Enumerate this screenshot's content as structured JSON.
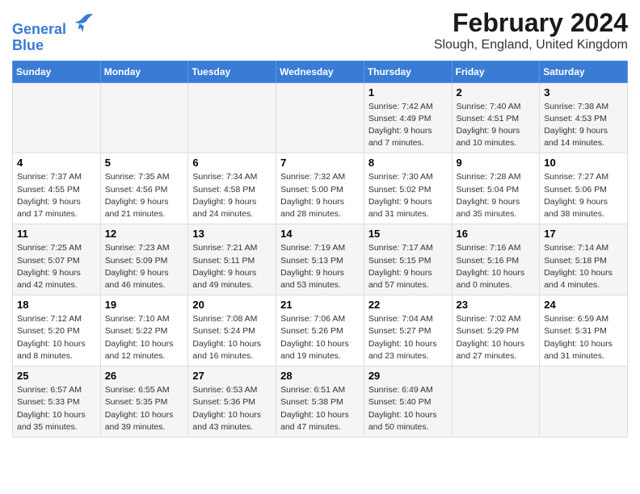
{
  "logo": {
    "line1": "General",
    "line2": "Blue"
  },
  "title": "February 2024",
  "location": "Slough, England, United Kingdom",
  "days_of_week": [
    "Sunday",
    "Monday",
    "Tuesday",
    "Wednesday",
    "Thursday",
    "Friday",
    "Saturday"
  ],
  "weeks": [
    [
      {
        "day": "",
        "info": ""
      },
      {
        "day": "",
        "info": ""
      },
      {
        "day": "",
        "info": ""
      },
      {
        "day": "",
        "info": ""
      },
      {
        "day": "1",
        "info": "Sunrise: 7:42 AM\nSunset: 4:49 PM\nDaylight: 9 hours\nand 7 minutes."
      },
      {
        "day": "2",
        "info": "Sunrise: 7:40 AM\nSunset: 4:51 PM\nDaylight: 9 hours\nand 10 minutes."
      },
      {
        "day": "3",
        "info": "Sunrise: 7:38 AM\nSunset: 4:53 PM\nDaylight: 9 hours\nand 14 minutes."
      }
    ],
    [
      {
        "day": "4",
        "info": "Sunrise: 7:37 AM\nSunset: 4:55 PM\nDaylight: 9 hours\nand 17 minutes."
      },
      {
        "day": "5",
        "info": "Sunrise: 7:35 AM\nSunset: 4:56 PM\nDaylight: 9 hours\nand 21 minutes."
      },
      {
        "day": "6",
        "info": "Sunrise: 7:34 AM\nSunset: 4:58 PM\nDaylight: 9 hours\nand 24 minutes."
      },
      {
        "day": "7",
        "info": "Sunrise: 7:32 AM\nSunset: 5:00 PM\nDaylight: 9 hours\nand 28 minutes."
      },
      {
        "day": "8",
        "info": "Sunrise: 7:30 AM\nSunset: 5:02 PM\nDaylight: 9 hours\nand 31 minutes."
      },
      {
        "day": "9",
        "info": "Sunrise: 7:28 AM\nSunset: 5:04 PM\nDaylight: 9 hours\nand 35 minutes."
      },
      {
        "day": "10",
        "info": "Sunrise: 7:27 AM\nSunset: 5:06 PM\nDaylight: 9 hours\nand 38 minutes."
      }
    ],
    [
      {
        "day": "11",
        "info": "Sunrise: 7:25 AM\nSunset: 5:07 PM\nDaylight: 9 hours\nand 42 minutes."
      },
      {
        "day": "12",
        "info": "Sunrise: 7:23 AM\nSunset: 5:09 PM\nDaylight: 9 hours\nand 46 minutes."
      },
      {
        "day": "13",
        "info": "Sunrise: 7:21 AM\nSunset: 5:11 PM\nDaylight: 9 hours\nand 49 minutes."
      },
      {
        "day": "14",
        "info": "Sunrise: 7:19 AM\nSunset: 5:13 PM\nDaylight: 9 hours\nand 53 minutes."
      },
      {
        "day": "15",
        "info": "Sunrise: 7:17 AM\nSunset: 5:15 PM\nDaylight: 9 hours\nand 57 minutes."
      },
      {
        "day": "16",
        "info": "Sunrise: 7:16 AM\nSunset: 5:16 PM\nDaylight: 10 hours\nand 0 minutes."
      },
      {
        "day": "17",
        "info": "Sunrise: 7:14 AM\nSunset: 5:18 PM\nDaylight: 10 hours\nand 4 minutes."
      }
    ],
    [
      {
        "day": "18",
        "info": "Sunrise: 7:12 AM\nSunset: 5:20 PM\nDaylight: 10 hours\nand 8 minutes."
      },
      {
        "day": "19",
        "info": "Sunrise: 7:10 AM\nSunset: 5:22 PM\nDaylight: 10 hours\nand 12 minutes."
      },
      {
        "day": "20",
        "info": "Sunrise: 7:08 AM\nSunset: 5:24 PM\nDaylight: 10 hours\nand 16 minutes."
      },
      {
        "day": "21",
        "info": "Sunrise: 7:06 AM\nSunset: 5:26 PM\nDaylight: 10 hours\nand 19 minutes."
      },
      {
        "day": "22",
        "info": "Sunrise: 7:04 AM\nSunset: 5:27 PM\nDaylight: 10 hours\nand 23 minutes."
      },
      {
        "day": "23",
        "info": "Sunrise: 7:02 AM\nSunset: 5:29 PM\nDaylight: 10 hours\nand 27 minutes."
      },
      {
        "day": "24",
        "info": "Sunrise: 6:59 AM\nSunset: 5:31 PM\nDaylight: 10 hours\nand 31 minutes."
      }
    ],
    [
      {
        "day": "25",
        "info": "Sunrise: 6:57 AM\nSunset: 5:33 PM\nDaylight: 10 hours\nand 35 minutes."
      },
      {
        "day": "26",
        "info": "Sunrise: 6:55 AM\nSunset: 5:35 PM\nDaylight: 10 hours\nand 39 minutes."
      },
      {
        "day": "27",
        "info": "Sunrise: 6:53 AM\nSunset: 5:36 PM\nDaylight: 10 hours\nand 43 minutes."
      },
      {
        "day": "28",
        "info": "Sunrise: 6:51 AM\nSunset: 5:38 PM\nDaylight: 10 hours\nand 47 minutes."
      },
      {
        "day": "29",
        "info": "Sunrise: 6:49 AM\nSunset: 5:40 PM\nDaylight: 10 hours\nand 50 minutes."
      },
      {
        "day": "",
        "info": ""
      },
      {
        "day": "",
        "info": ""
      }
    ]
  ]
}
